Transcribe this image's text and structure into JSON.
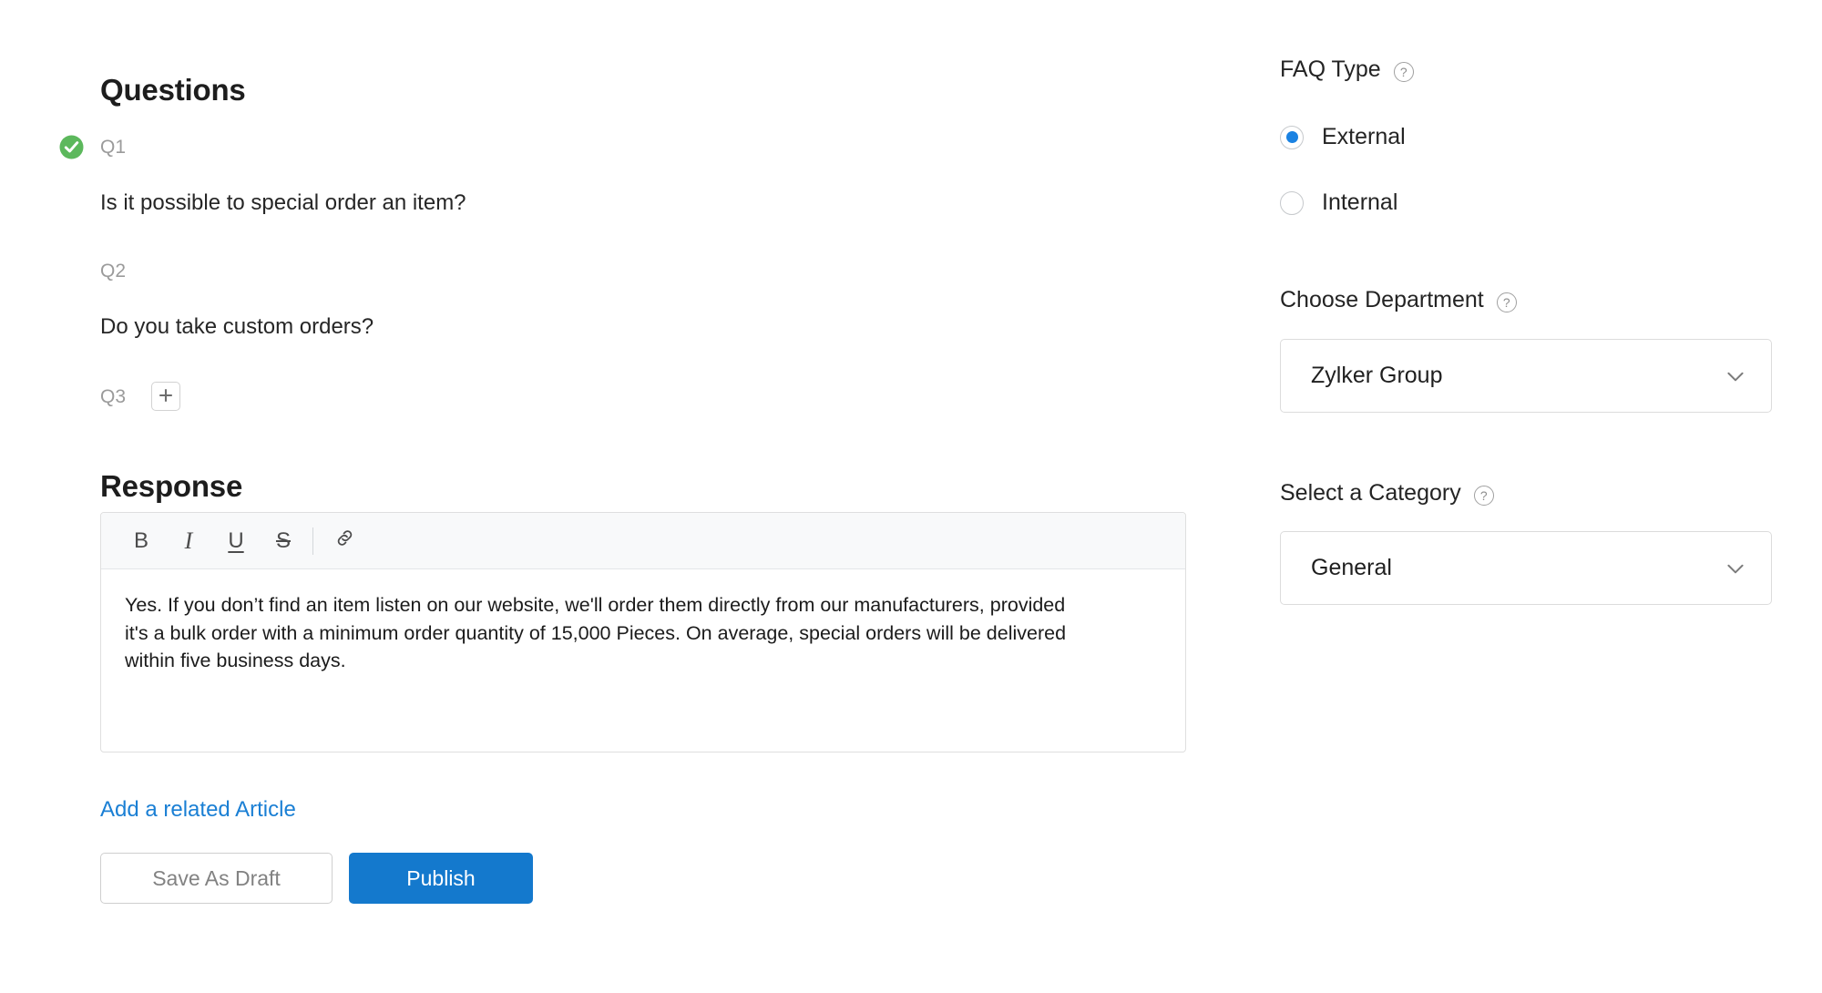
{
  "left": {
    "questions_heading": "Questions",
    "questions": [
      {
        "label": "Q1",
        "text": "Is it possible to special order an item?",
        "status": "completed"
      },
      {
        "label": "Q2",
        "text": "Do you take custom orders?",
        "status": "none"
      },
      {
        "label": "Q3",
        "text": "",
        "status": "add"
      }
    ],
    "response_heading": "Response",
    "toolbar": {
      "bold": "B",
      "italic": "I",
      "underline": "U",
      "strikethrough": "S",
      "link_icon": "link-icon"
    },
    "response_text": "Yes. If you don’t find an item listen on our website, we'll order them directly from our manufacturers, provided it's a bulk order with a minimum order quantity of 15,000 Pieces. On average, special orders will be delivered within five business days.",
    "related_article_link": "Add a related Article",
    "save_draft_label": "Save As Draft",
    "publish_label": "Publish"
  },
  "right": {
    "faq_type": {
      "label": "FAQ Type",
      "help": "?",
      "options": [
        {
          "label": "External",
          "selected": true
        },
        {
          "label": "Internal",
          "selected": false
        }
      ]
    },
    "department": {
      "label": "Choose Department",
      "help": "?",
      "value": "Zylker Group"
    },
    "category": {
      "label": "Select a Category",
      "help": "?",
      "value": "General"
    }
  },
  "colors": {
    "accent_blue": "#1479cd",
    "link_blue": "#1a7fd4",
    "radio_blue": "#1a82e2",
    "success_green": "#5cb85c",
    "muted_gray": "#9b9b9b",
    "border_gray": "#dcdcdc",
    "toolbar_bg": "#f8f9fa"
  }
}
